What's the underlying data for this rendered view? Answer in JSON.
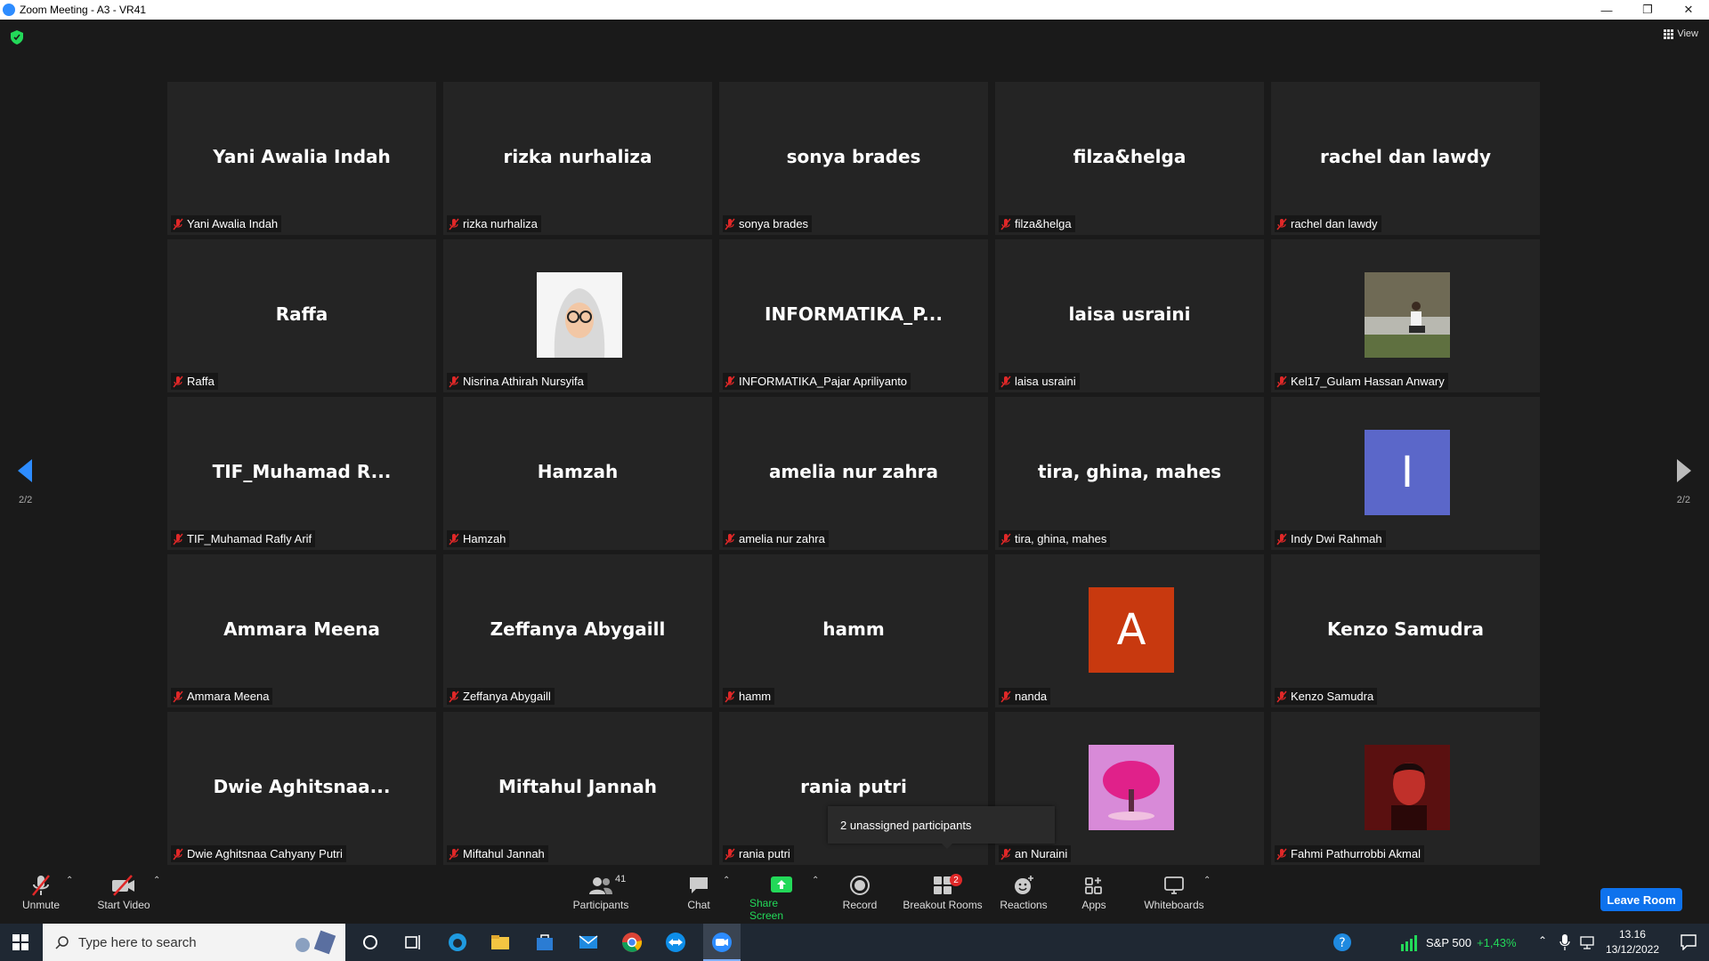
{
  "window": {
    "title": "Zoom Meeting - A3 - VR41",
    "view_label": "View"
  },
  "colors": {
    "accent": "#0e72ed",
    "share_green": "#23d959",
    "muted_red": "#e02828",
    "tile_bg": "#242424"
  },
  "pagination": {
    "left": "2/2",
    "right": "2/2"
  },
  "tiles": [
    {
      "big": "Yani Awalia Indah",
      "label": "Yani Awalia Indah"
    },
    {
      "big": "rizka nurhaliza",
      "label": "rizka nurhaliza"
    },
    {
      "big": "sonya brades",
      "label": "sonya brades"
    },
    {
      "big": "filza&helga",
      "label": "filza&helga"
    },
    {
      "big": "rachel dan lawdy",
      "label": "rachel dan lawdy"
    },
    {
      "big": "Raffa",
      "label": "Raffa"
    },
    {
      "big": "",
      "label": "Nisrina Athirah Nursyifa",
      "avatar": "hijab-avatar"
    },
    {
      "big": "INFORMATIKA_P...",
      "label": "INFORMATIKA_Pajar Apriliyanto"
    },
    {
      "big": "laisa usraini",
      "label": "laisa usraini"
    },
    {
      "big": "",
      "label": "Kel17_Gulam Hassan Anwary",
      "avatar": "photo-street"
    },
    {
      "big": "TIF_Muhamad  R...",
      "label": "TIF_Muhamad Rafly Arif"
    },
    {
      "big": "Hamzah",
      "label": "Hamzah"
    },
    {
      "big": "amelia nur zahra",
      "label": "amelia nur zahra"
    },
    {
      "big": "tira, ghina, mahes",
      "label": "tira, ghina, mahes"
    },
    {
      "big": "",
      "label": "Indy Dwi Rahmah",
      "avatar_letter": "I",
      "avatar_color": "#5b67c9"
    },
    {
      "big": "Ammara Meena",
      "label": "Ammara Meena"
    },
    {
      "big": "Zeffanya Abygaill",
      "label": "Zeffanya Abygaill"
    },
    {
      "big": "hamm",
      "label": "hamm"
    },
    {
      "big": "",
      "label": "nanda",
      "avatar_letter": "A",
      "avatar_color": "#c8390f"
    },
    {
      "big": "Kenzo Samudra",
      "label": "Kenzo Samudra"
    },
    {
      "big": "Dwie  Aghitsnaa...",
      "label": "Dwie Aghitsnaa Cahyany Putri"
    },
    {
      "big": "Miftahul Jannah",
      "label": "Miftahul Jannah"
    },
    {
      "big": "rania putri",
      "label": "rania putri"
    },
    {
      "big": "",
      "label": "an Nuraini",
      "avatar": "pink-tree"
    },
    {
      "big": "",
      "label": "Fahmi Pathurrobbi Akmal",
      "avatar": "photo-portrait-red"
    }
  ],
  "popup": {
    "text": "2 unassigned participants"
  },
  "toolbar": {
    "unmute": "Unmute",
    "start_video": "Start Video",
    "participants": "Participants",
    "participants_count": "41",
    "chat": "Chat",
    "share_screen": "Share Screen",
    "record": "Record",
    "breakout_rooms": "Breakout Rooms",
    "breakout_badge": "2",
    "reactions": "Reactions",
    "apps": "Apps",
    "whiteboards": "Whiteboards",
    "leave_room": "Leave Room"
  },
  "taskbar": {
    "search_placeholder": "Type here to search",
    "stock_name": "S&P 500",
    "stock_change": "+1,43%",
    "time": "13.16",
    "date": "13/12/2022"
  }
}
